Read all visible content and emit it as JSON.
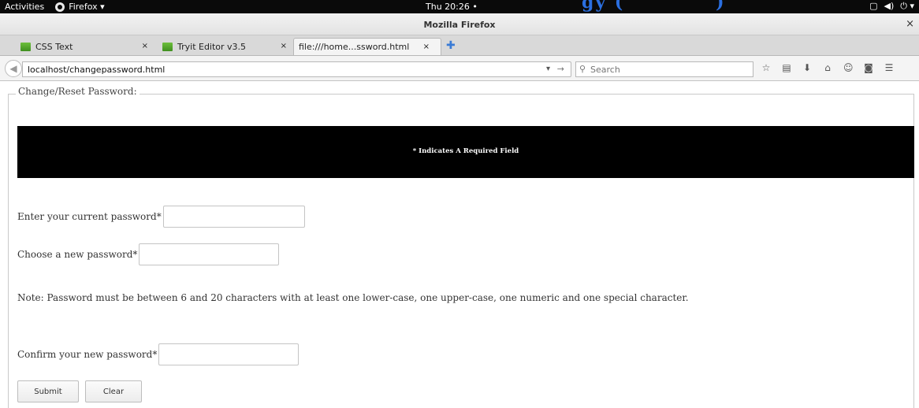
{
  "system_bar": {
    "activities": "Activities",
    "app_name": "Firefox ▾",
    "clock": "Thu 20:26 •",
    "overlay_text": "gy (",
    "overlay_text_right": ")"
  },
  "window": {
    "title": "Mozilla Firefox",
    "close": "×"
  },
  "tabs": [
    {
      "label": "CSS Text",
      "close": "×"
    },
    {
      "label": "Tryit Editor v3.5",
      "close": "×"
    },
    {
      "label": "file:///home...ssword.html",
      "close": "×"
    }
  ],
  "navbar": {
    "url": "localhost/changepassword.html",
    "search_placeholder": "Search"
  },
  "form": {
    "legend": "Change/Reset Password:",
    "required_note": "* Indicates A Required Field",
    "current_password_label": "Enter your current password*",
    "new_password_label": "Choose a new password*",
    "note": "Note: Password must be between 6 and 20 characters with at least one lower-case, one upper-case, one numeric and one special character.",
    "confirm_password_label": "Confirm your new password*",
    "submit_label": "Submit",
    "clear_label": "Clear"
  },
  "colors": {
    "banner_bg": "#000000",
    "top_bar_bg": "#0a0a0a",
    "overlay_blue": "#2b6fe0"
  }
}
